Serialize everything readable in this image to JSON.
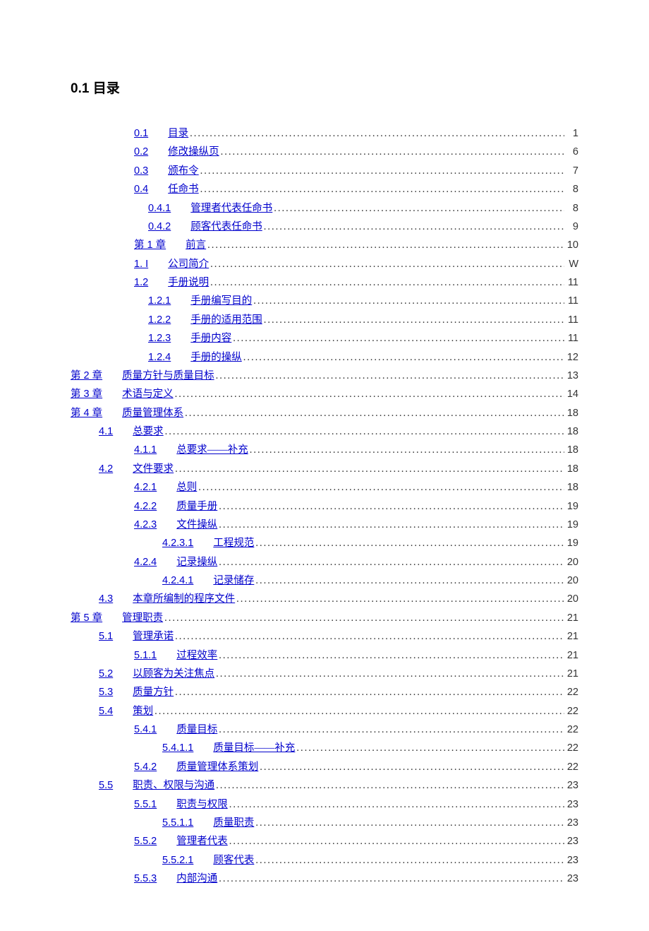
{
  "heading": "0.1 目录",
  "toc": [
    {
      "indent": "ind-1",
      "num": "0.1",
      "label": "目录",
      "page": "1"
    },
    {
      "indent": "ind-1",
      "num": "0.2",
      "label": "修改操纵页",
      "page": "6"
    },
    {
      "indent": "ind-1",
      "num": "0.3",
      "label": "颁布令",
      "page": "7"
    },
    {
      "indent": "ind-1",
      "num": "0.4",
      "label": "任命书",
      "page": "8"
    },
    {
      "indent": "ind-2",
      "num": "0.4.1",
      "label": "管理者代表任命书",
      "page": "8"
    },
    {
      "indent": "ind-2",
      "num": "0.4.2",
      "label": "顾客代表任命书",
      "page": "9"
    },
    {
      "indent": "ind-1",
      "num": "第 1 章",
      "label": "前言",
      "page": "10"
    },
    {
      "indent": "ind-1",
      "num": "1. I",
      "label": "公司简介",
      "page": "W"
    },
    {
      "indent": "ind-1",
      "num": "1.2",
      "label": "手册说明",
      "page": "11"
    },
    {
      "indent": "ind-2",
      "num": "1.2.1",
      "label": "手册编写目的",
      "page": "11"
    },
    {
      "indent": "ind-2",
      "num": "1.2.2",
      "label": "手册的适用范围",
      "page": "11"
    },
    {
      "indent": "ind-2",
      "num": "1.2.3",
      "label": "手册内容",
      "page": "11"
    },
    {
      "indent": "ind-2",
      "num": "1.2.4",
      "label": "手册的操纵",
      "page": "12"
    },
    {
      "indent": "ind-base",
      "num": "第 2 章",
      "label": "质量方针与质量目标",
      "page": "13"
    },
    {
      "indent": "ind-base",
      "num": "第 3 章",
      "label": "术语与定义",
      "page": "14"
    },
    {
      "indent": "ind-base",
      "num": "第 4 章",
      "label": "质量管理体系",
      "page": "18"
    },
    {
      "indent": "indc-1",
      "num": "4.1",
      "label": "总要求",
      "page": "18"
    },
    {
      "indent": "indc-2",
      "num": "4.1.1",
      "label": "总要求——补充",
      "page": "18"
    },
    {
      "indent": "indc-1",
      "num": "4.2",
      "label": "文件要求",
      "page": "18"
    },
    {
      "indent": "indc-2",
      "num": "4.2.1",
      "label": "总则",
      "page": "18"
    },
    {
      "indent": "indc-2",
      "num": "4.2.2",
      "label": "质量手册",
      "page": "19"
    },
    {
      "indent": "indc-2",
      "num": "4.2.3",
      "label": "文件操纵",
      "page": "19"
    },
    {
      "indent": "indc-3",
      "num": "4.2.3.1",
      "label": "工程规范",
      "page": "19"
    },
    {
      "indent": "indc-2",
      "num": "4.2.4",
      "label": "记录操纵",
      "page": "20"
    },
    {
      "indent": "indc-3",
      "num": "4.2.4.1",
      "label": "记录储存",
      "page": "20"
    },
    {
      "indent": "indc-1",
      "num": "4.3",
      "label": "本章所编制的程序文件",
      "page": "20"
    },
    {
      "indent": "ind-base",
      "num": "第 5 章",
      "label": "管理职责",
      "page": "21"
    },
    {
      "indent": "indc-1",
      "num": "5.1",
      "label": "管理承诺",
      "page": "21"
    },
    {
      "indent": "indc-2",
      "num": "5.1.1",
      "label": "过程效率",
      "page": "21"
    },
    {
      "indent": "indc-1",
      "num": "5.2",
      "label": "以顾客为关注焦点",
      "page": "21"
    },
    {
      "indent": "indc-1",
      "num": "5.3",
      "label": "质量方针",
      "page": "22"
    },
    {
      "indent": "indc-1",
      "num": "5.4",
      "label": "策划",
      "page": "22"
    },
    {
      "indent": "indc-2",
      "num": "5.4.1",
      "label": "质量目标",
      "page": "22"
    },
    {
      "indent": "indc-3",
      "num": "5.4.1.1",
      "label": "质量目标——补充",
      "page": "22"
    },
    {
      "indent": "indc-2",
      "num": "5.4.2",
      "label": "质量管理体系策划",
      "page": "22"
    },
    {
      "indent": "indc-1",
      "num": "5.5",
      "label": "职责、权限与沟通",
      "page": "23"
    },
    {
      "indent": "indc-2",
      "num": "5.5.1",
      "label": "职责与权限",
      "page": "23"
    },
    {
      "indent": "indc-3",
      "num": "5.5.1.1",
      "label": "质量职责",
      "page": "23"
    },
    {
      "indent": "indc-2",
      "num": "5.5.2",
      "label": "管理者代表",
      "page": "23"
    },
    {
      "indent": "indc-3",
      "num": "5.5.2.1",
      "label": "顾客代表",
      "page": "23"
    },
    {
      "indent": "indc-2",
      "num": "5.5.3",
      "label": "内部沟通",
      "page": "23"
    }
  ]
}
